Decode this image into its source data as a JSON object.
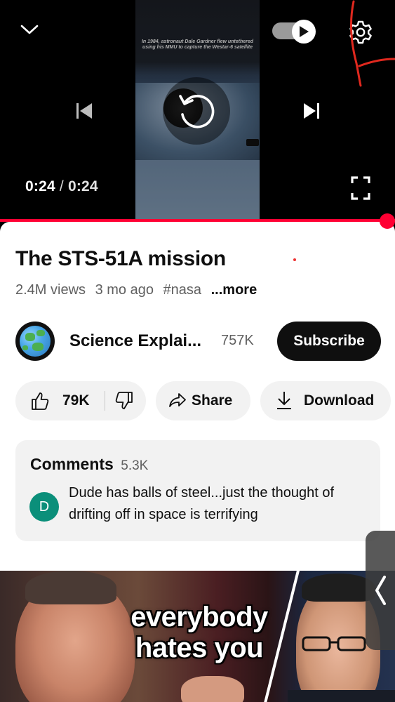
{
  "player": {
    "overlay_caption": "In 1984, astronaut Dale Gardner flew untethered using his MMU to capture the Westar-6 satellite",
    "current_time": "0:24",
    "separator": "/",
    "duration": "0:24",
    "progress": 1.0,
    "autoplay_on": true,
    "icons": [
      "chevron-down-icon",
      "autoplay-toggle",
      "gear-icon",
      "previous-icon",
      "replay-icon",
      "next-icon",
      "fullscreen-icon"
    ]
  },
  "video": {
    "title": "The STS-51A mission",
    "views": "2.4M views",
    "age": "3 mo ago",
    "hashtag": "#nasa",
    "more": "...more"
  },
  "channel": {
    "name": "Science Explai...",
    "subscribers": "757K",
    "subscribe_label": "Subscribe"
  },
  "actions": {
    "like_count": "79K",
    "share_label": "Share",
    "download_label": "Download"
  },
  "comments": {
    "header": "Comments",
    "count": "5.3K",
    "top_comment": {
      "avatar_letter": "D",
      "text": "Dude has balls of steel...just the thought of drifting off in space is terrifying"
    }
  },
  "meme": {
    "caption": "everybody hates you"
  },
  "colors": {
    "accent_red": "#ff0033",
    "subscribe_bg": "#0f0f0f",
    "pill_bg": "#f2f2f2",
    "comment_avatar": "#0b8f7a"
  }
}
